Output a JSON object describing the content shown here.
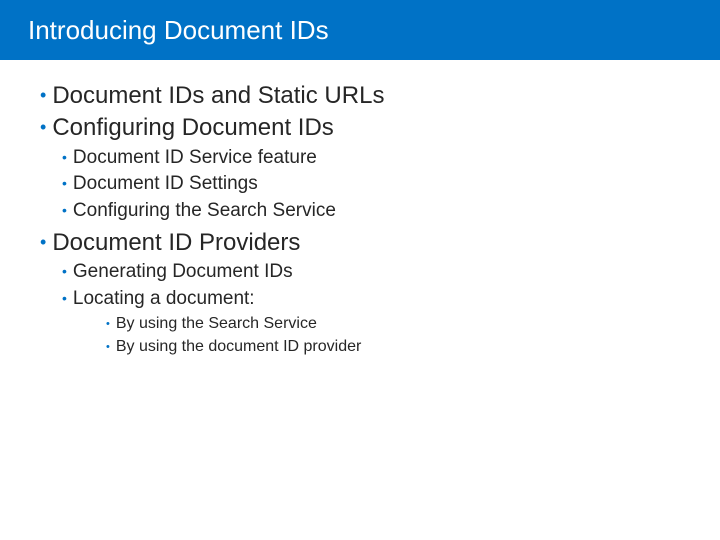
{
  "title": "Introducing Document IDs",
  "outline": {
    "item0": "Document IDs and Static URLs",
    "item1": "Configuring Document IDs",
    "item1_sub": {
      "s0": "Document ID Service feature",
      "s1": "Document ID Settings",
      "s2": "Configuring the Search Service"
    },
    "item2": "Document ID Providers",
    "item2_sub": {
      "s0": "Generating Document IDs",
      "s1": "Locating a document:",
      "s1_sub": {
        "t0": "By using the Search Service",
        "t1": "By using the document ID provider"
      }
    }
  }
}
